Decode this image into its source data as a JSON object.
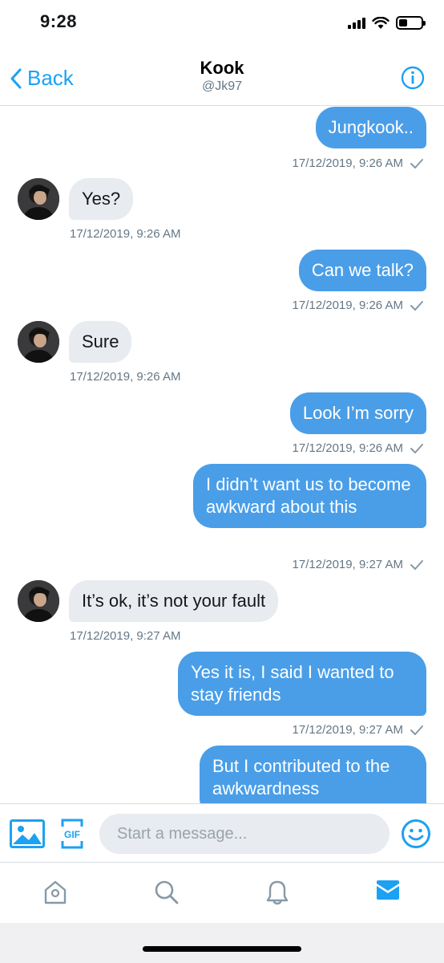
{
  "status_bar": {
    "time": "9:28"
  },
  "header": {
    "back_label": "Back",
    "title": "Kook",
    "handle": "@Jk97"
  },
  "messages": [
    {
      "text": "Jungkook..",
      "meta": "17/12/2019, 9:26 AM"
    },
    {
      "text": "Yes?",
      "meta": "17/12/2019, 9:26 AM"
    },
    {
      "text": "Can we talk?",
      "meta": "17/12/2019, 9:26 AM"
    },
    {
      "text": "Sure",
      "meta": "17/12/2019, 9:26 AM"
    },
    {
      "text": "Look I’m sorry",
      "meta": "17/12/2019, 9:26 AM"
    },
    {
      "text": "I didn’t want us to become awkward about this",
      "meta": "17/12/2019, 9:27 AM"
    },
    {
      "text": "It’s ok, it’s not your fault",
      "meta": "17/12/2019, 9:27 AM"
    },
    {
      "text": "Yes it is, I said I wanted to stay friends",
      "meta": "17/12/2019, 9:27 AM"
    },
    {
      "text": "But I contributed to the awkwardness",
      "meta": ""
    }
  ],
  "composer": {
    "placeholder": "Start a message...",
    "gif_label": "GIF"
  },
  "colors": {
    "accent": "#1da1f2",
    "outgoing_bubble": "#4a9ee8",
    "incoming_bubble": "#e8ebef",
    "meta_text": "#657786"
  },
  "icons": {
    "back": "chevron-left-icon",
    "info": "info-icon",
    "image": "image-icon",
    "gif": "gif-icon",
    "emoji": "smiley-icon",
    "tabs": [
      "home-icon",
      "search-icon",
      "bell-icon",
      "envelope-icon"
    ]
  }
}
